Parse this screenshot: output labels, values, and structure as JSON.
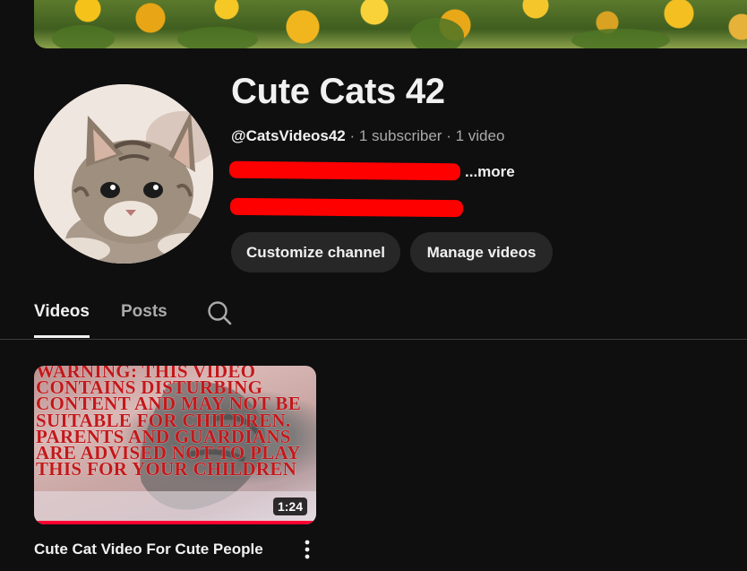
{
  "channel": {
    "name": "Cute Cats 42",
    "handle": "@CatsVideos42",
    "subscribers": "1 subscriber",
    "video_count": "1 video",
    "separator": " · ",
    "more_link": "...more"
  },
  "actions": {
    "customize_label": "Customize channel",
    "manage_label": "Manage videos"
  },
  "tabs": [
    {
      "label": "Videos",
      "active": true
    },
    {
      "label": "Posts",
      "active": false
    }
  ],
  "icons": {
    "search": "search-icon",
    "more": "more-vert-icon"
  },
  "videos": [
    {
      "title": "Cute Cat Video For Cute People",
      "duration": "1:24",
      "thumbnail_text": "WARNING: THIS VIDEO CONTAINS DISTURBING CONTENT AND MAY NOT BE SUITABLE FOR CHILDREN. PARENTS AND GUARDIANS ARE ADVISED NOT TO PLAY THIS FOR YOUR CHILDREN"
    }
  ],
  "colors": {
    "background": "#0f0f0f",
    "button_bg": "#272727",
    "redaction": "#ff0000",
    "progress": "#ff0033",
    "text_primary": "#f1f1f1",
    "text_secondary": "#aaaaaa"
  }
}
